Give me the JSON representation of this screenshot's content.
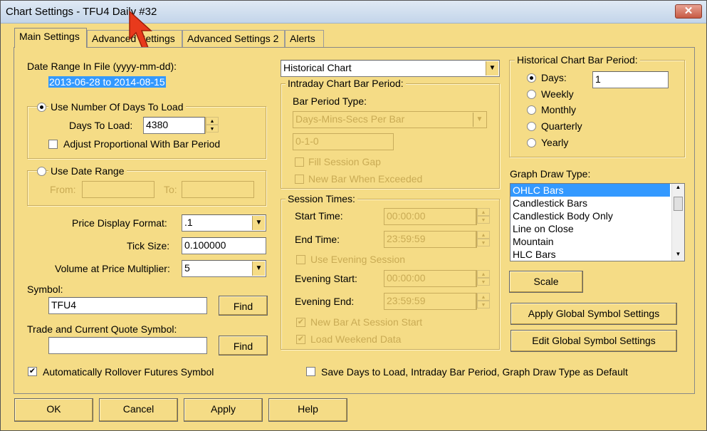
{
  "window": {
    "title": "Chart Settings - TFU4  Daily  #32",
    "close_label": "✕"
  },
  "tabs": [
    {
      "label": "Main Settings"
    },
    {
      "label": "Advanced Settings"
    },
    {
      "label": "Advanced Settings 2"
    },
    {
      "label": "Alerts"
    }
  ],
  "date_range": {
    "label": "Date Range In File (yyyy-mm-dd):",
    "value": "2013-06-28 to 2014-08-15"
  },
  "days_group": {
    "label": "Use Number Of Days To Load",
    "days_label": "Days To Load:",
    "days_value": "4380",
    "adjust_label": "Adjust Proportional With Bar Period"
  },
  "date_range_group": {
    "label": "Use Date Range",
    "from_label": "From:",
    "to_label": "To:"
  },
  "price_format": {
    "label": "Price Display Format:",
    "value": ".1"
  },
  "tick_size": {
    "label": "Tick Size:",
    "value": "0.100000"
  },
  "volume_multiplier": {
    "label": "Volume at Price Multiplier:",
    "value": "5"
  },
  "symbol": {
    "label": "Symbol:",
    "value": "TFU4",
    "find_label": "Find"
  },
  "trade_symbol": {
    "label": "Trade and Current Quote Symbol:",
    "value": "",
    "find_label": "Find"
  },
  "auto_rollover": {
    "label": "Automatically Rollover Futures Symbol",
    "checked": true
  },
  "chart_type_select": {
    "value": "Historical Chart"
  },
  "intraday": {
    "label": "Intraday Chart Bar Period:",
    "bar_period_type_label": "Bar Period Type:",
    "bar_period_type_value": "Days-Mins-Secs Per Bar",
    "period_value": "0-1-0",
    "fill_gap_label": "Fill Session Gap",
    "new_bar_label": "New Bar When Exceeded"
  },
  "session": {
    "label": "Session Times:",
    "start_label": "Start Time:",
    "start_value": "00:00:00",
    "end_label": "End Time:",
    "end_value": "23:59:59",
    "evening_check_label": "Use Evening Session",
    "evening_start_label": "Evening Start:",
    "evening_start_value": "00:00:00",
    "evening_end_label": "Evening End:",
    "evening_end_value": "23:59:59",
    "new_bar_session_label": "New Bar At Session Start",
    "load_weekend_label": "Load Weekend Data"
  },
  "historical_period": {
    "label": "Historical Chart Bar Period:",
    "options": [
      "Days:",
      "Weekly",
      "Monthly",
      "Quarterly",
      "Yearly"
    ],
    "days_value": "1"
  },
  "graph_draw": {
    "label": "Graph Draw Type:",
    "items": [
      "OHLC Bars",
      "Candlestick Bars",
      "Candlestick Body Only",
      "Line on Close",
      "Mountain",
      "HLC Bars"
    ]
  },
  "buttons": {
    "scale": "Scale",
    "apply_global": "Apply Global Symbol Settings",
    "edit_global": "Edit Global Symbol Settings",
    "ok": "OK",
    "cancel": "Cancel",
    "apply": "Apply",
    "help": "Help"
  },
  "save_default": {
    "label": "Save Days to Load, Intraday Bar Period, Graph Draw Type as Default"
  },
  "colors": {
    "dialog_bg": "#f5dc86",
    "selection": "#3399ff",
    "close_red": "#c75a44"
  }
}
